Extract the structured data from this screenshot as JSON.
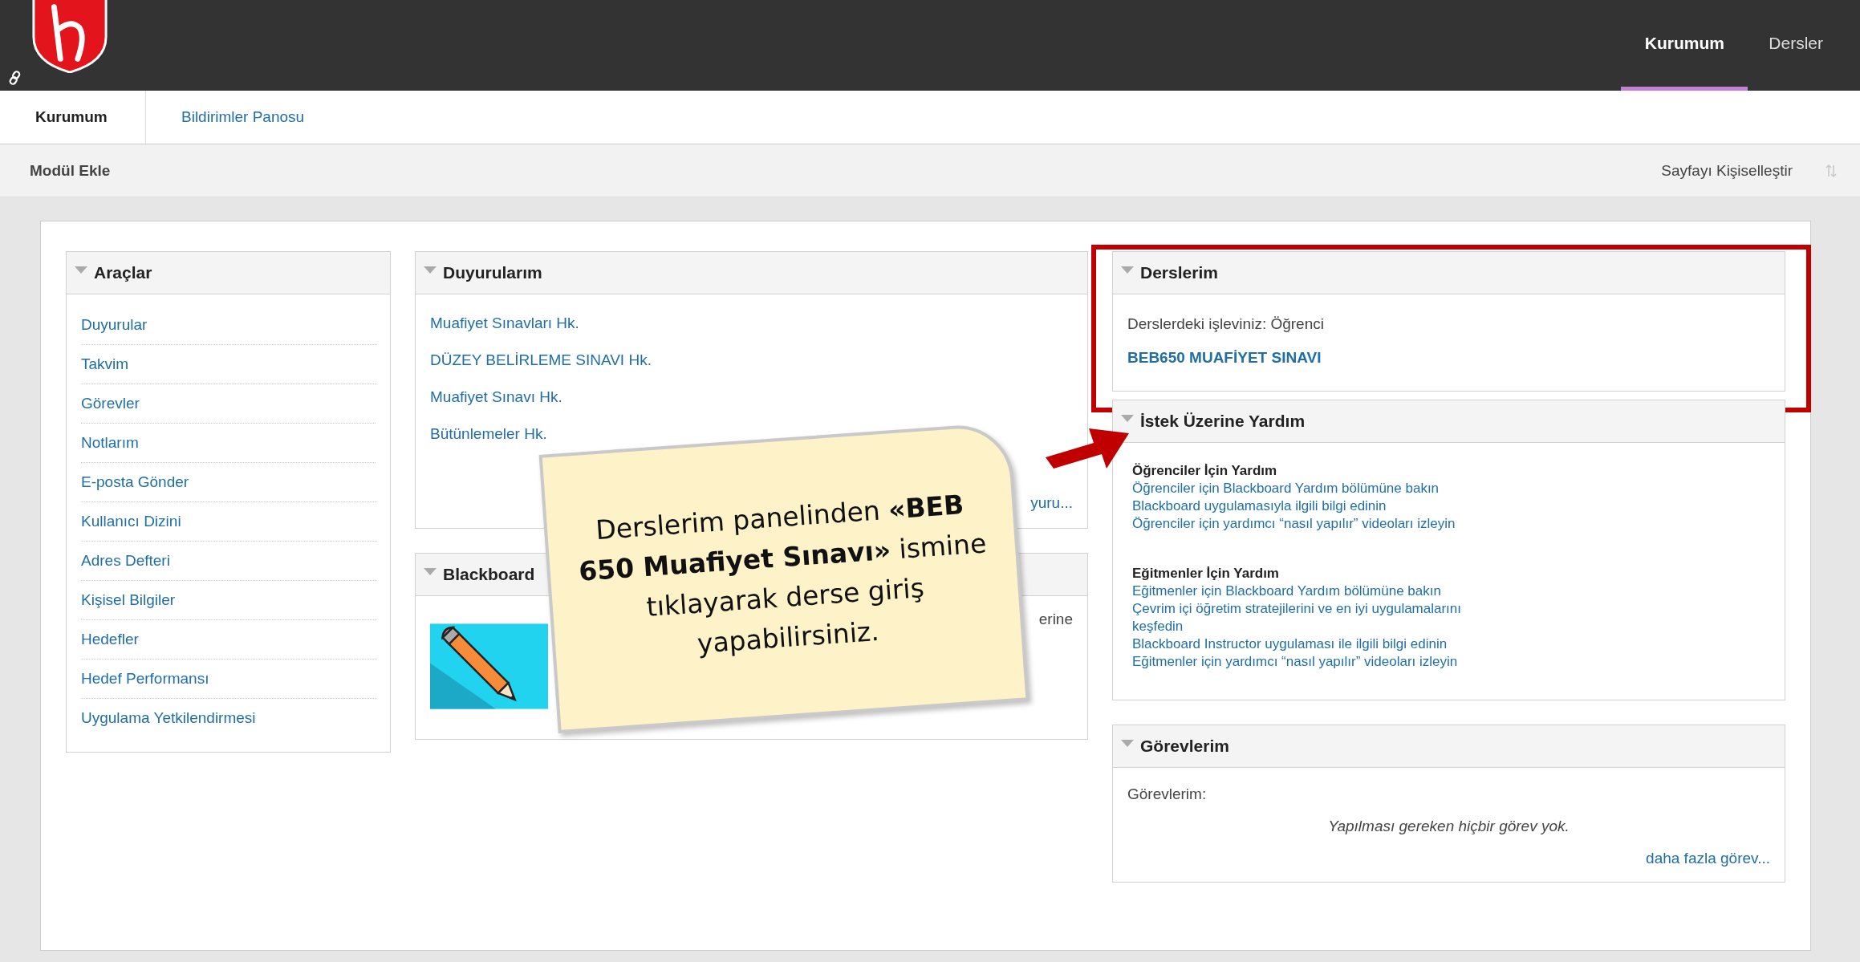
{
  "top_nav": [
    {
      "label": "Kurumum",
      "selected": true
    },
    {
      "label": "Dersler",
      "selected": false
    }
  ],
  "tabs": [
    {
      "label": "Kurumum",
      "selected": true
    },
    {
      "label": "Bildirimler Panosu",
      "selected": false
    }
  ],
  "toolbar": {
    "add_module": "Modül Ekle",
    "personalize": "Sayfayı Kişiselleştir"
  },
  "tools_panel": {
    "title": "Araçlar",
    "items": [
      "Duyurular",
      "Takvim",
      "Görevler",
      "Notlarım",
      "E-posta Gönder",
      "Kullanıcı Dizini",
      "Adres Defteri",
      "Kişisel Bilgiler",
      "Hedefler",
      "Hedef Performansı",
      "Uygulama Yetkilendirmesi"
    ]
  },
  "announcements_panel": {
    "title": "Duyurularım",
    "items": [
      "Muafiyet Sınavları Hk.",
      "DÜZEY BELİRLEME SINAVI Hk.",
      "Muafiyet Sınavı Hk.",
      "Bütünlemeler Hk."
    ],
    "more": "yuru..."
  },
  "blackboard_panel": {
    "title": "Blackboard",
    "text": "erine"
  },
  "courses_panel": {
    "title": "Derslerim",
    "role": "Derslerdeki işleviniz: Öğrenci",
    "course": "BEB650 MUAFİYET SINAVI",
    "highlighted": true
  },
  "help_panel": {
    "title": "İstek Üzerine Yardım",
    "sections": [
      {
        "heading": "Öğrenciler İçin Yardım",
        "links": [
          "Öğrenciler için Blackboard Yardım bölümüne bakın",
          "Blackboard uygulamasıyla ilgili bilgi edinin",
          "Öğrenciler için yardımcı “nasıl yapılır” videoları izleyin"
        ]
      },
      {
        "heading": "Eğitmenler İçin Yardım",
        "links": [
          "Eğitmenler için Blackboard Yardım bölümüne bakın",
          "Çevrim içi öğretim stratejilerini ve en iyi uygulamalarını keşfedin",
          "Blackboard Instructor uygulaması ile ilgili bilgi edinin",
          "Eğitmenler için yardımcı “nasıl yapılır” videoları izleyin"
        ]
      }
    ]
  },
  "tasks_panel": {
    "title": "Görevlerim",
    "label": "Görevlerim:",
    "empty": "Yapılması gereken hiçbir görev yok.",
    "more": "daha fazla görev..."
  },
  "callout": {
    "text": "Derslerim panelinden **«BEB 650 Muafiyet Sınavı»** ismine tıklayarak derse giriş yapabilirsiniz."
  }
}
